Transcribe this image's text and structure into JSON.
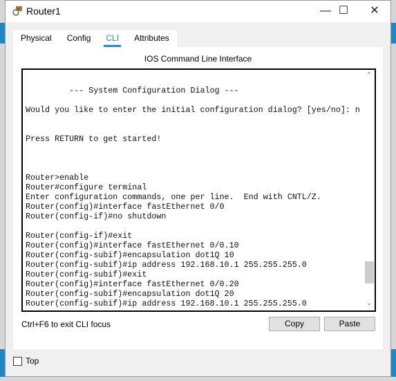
{
  "window": {
    "title": "Router1",
    "icon": "router-icon",
    "controls": [
      "minimize",
      "maximize",
      "close"
    ]
  },
  "tabs": [
    {
      "label": "Physical"
    },
    {
      "label": "Config"
    },
    {
      "label": "CLI",
      "active": true
    },
    {
      "label": "Attributes"
    }
  ],
  "panel": {
    "header": "IOS Command Line Interface"
  },
  "terminal": {
    "lines": [
      "",
      "         --- System Configuration Dialog ---",
      "",
      "Would you like to enter the initial configuration dialog? [yes/no]: n",
      "",
      "",
      "Press RETURN to get started!",
      "",
      "",
      "",
      "Router>enable",
      "Router#configure terminal",
      "Enter configuration commands, one per line.  End with CNTL/Z.",
      "Router(config)#interface fastEthernet 0/0",
      "Router(config-if)#no shutdown",
      "",
      "Router(config-if)#exit",
      "Router(config)#interface fastEthernet 0/0.10",
      "Router(config-subif)#encapsulation dot1Q 10",
      "Router(config-subif)#ip address 192.168.10.1 255.255.255.0",
      "Router(config-subif)#exit",
      "Router(config)#interface fastEthernet 0/0.20",
      "Router(config-subif)#encapsulation dot1Q 20",
      "Router(config-subif)#ip address 192.168.10.1 255.255.255.0"
    ]
  },
  "footer": {
    "hint": "Ctrl+F6 to exit CLI focus",
    "copy": "Copy",
    "paste": "Paste"
  },
  "top_checkbox": {
    "label": "Top",
    "checked": false
  },
  "colors": {
    "accent": "#1a8fd0"
  }
}
